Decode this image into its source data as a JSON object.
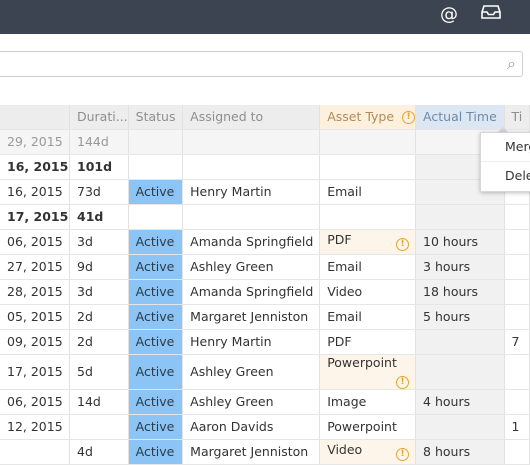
{
  "topbar": {
    "mention_icon": "at-icon",
    "inbox_icon": "inbox-icon"
  },
  "search": {
    "value": "",
    "icon": "search-icon"
  },
  "table": {
    "headers": [
      "",
      "Durati...",
      "Status",
      "Assigned to",
      "Asset Type",
      "Actual Time",
      "Ti"
    ],
    "rows": [
      {
        "date": "29, 2015",
        "duration": "144d",
        "status": "",
        "assigned": "",
        "asset": "",
        "asset_warn": false,
        "actual": "",
        "ti": "",
        "style": "grey"
      },
      {
        "date": "16, 2015",
        "duration": "101d",
        "status": "",
        "assigned": "",
        "asset": "",
        "asset_warn": false,
        "actual": "",
        "ti": "",
        "style": "bold"
      },
      {
        "date": "16, 2015",
        "duration": "73d",
        "status": "Active",
        "assigned": "Henry Martin",
        "asset": "Email",
        "asset_warn": false,
        "actual": "",
        "ti": "",
        "style": ""
      },
      {
        "date": "17, 2015",
        "duration": "41d",
        "status": "",
        "assigned": "",
        "asset": "",
        "asset_warn": false,
        "actual": "",
        "ti": "",
        "style": "bold"
      },
      {
        "date": "06, 2015",
        "duration": "3d",
        "status": "Active",
        "assigned": "Amanda Springfield",
        "asset": "PDF",
        "asset_warn": true,
        "actual": "10 hours",
        "ti": "",
        "style": ""
      },
      {
        "date": "27, 2015",
        "duration": "9d",
        "status": "Active",
        "assigned": "Ashley Green",
        "asset": "Email",
        "asset_warn": false,
        "actual": "3 hours",
        "ti": "",
        "style": ""
      },
      {
        "date": "28, 2015",
        "duration": "3d",
        "status": "Active",
        "assigned": "Amanda Springfield",
        "asset": "Video",
        "asset_warn": false,
        "actual": "18 hours",
        "ti": "",
        "style": ""
      },
      {
        "date": "05, 2015",
        "duration": "2d",
        "status": "Active",
        "assigned": "Margaret Jenniston",
        "asset": "Email",
        "asset_warn": false,
        "actual": "5 hours",
        "ti": "",
        "style": ""
      },
      {
        "date": "09, 2015",
        "duration": "2d",
        "status": "Active",
        "assigned": "Henry Martin",
        "asset": "PDF",
        "asset_warn": false,
        "actual": "",
        "ti": "7",
        "style": ""
      },
      {
        "date": "17, 2015",
        "duration": "5d",
        "status": "Active",
        "assigned": "Ashley Green",
        "asset": "Powerpoint",
        "asset_warn": true,
        "actual": "",
        "ti": "",
        "style": ""
      },
      {
        "date": "06, 2015",
        "duration": "14d",
        "status": "Active",
        "assigned": "Ashley Green",
        "asset": "Image",
        "asset_warn": false,
        "actual": "4 hours",
        "ti": "",
        "style": ""
      },
      {
        "date": "12, 2015",
        "duration": "",
        "status": "Active",
        "assigned": "Aaron Davids",
        "asset": "Powerpoint",
        "asset_warn": false,
        "actual": "",
        "ti": "1",
        "style": ""
      },
      {
        "date": "",
        "duration": "4d",
        "status": "Active",
        "assigned": "Margaret Jenniston",
        "asset": "Video",
        "asset_warn": true,
        "actual": "8 hours",
        "ti": "",
        "style": ""
      }
    ]
  },
  "context_menu": {
    "items": [
      "Merg",
      "Dele"
    ]
  },
  "colors": {
    "topbar": "#3c4452",
    "active": "#8cc5f5",
    "asset_header": "#fdf0dd",
    "actual_header": "#dde7f3",
    "warning": "#e3a431"
  }
}
